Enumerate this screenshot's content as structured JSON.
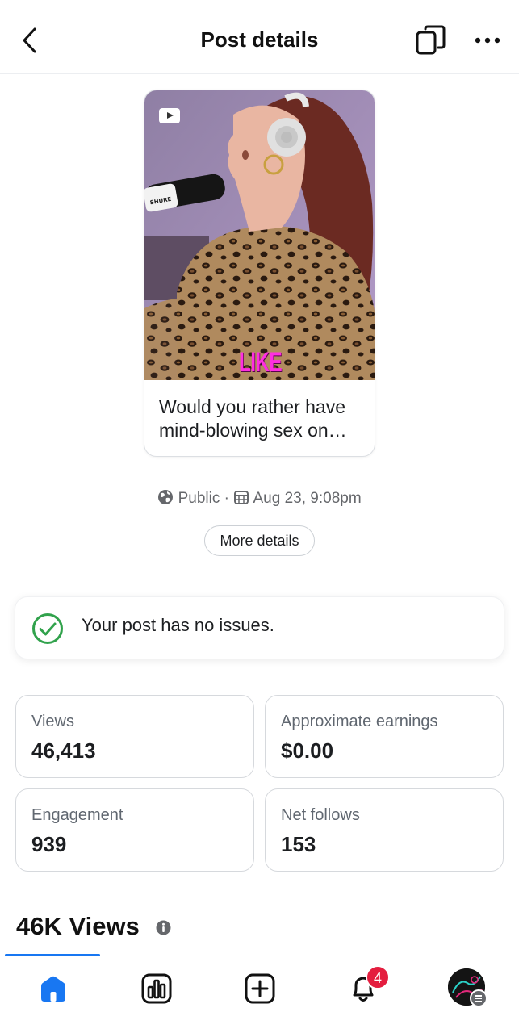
{
  "header": {
    "title": "Post details"
  },
  "post": {
    "caption_overlay": "LIKE",
    "text": "Would you rather have mind-blowing sex on…",
    "visibility": "Public",
    "separator": "·",
    "date": "Aug 23, 9:08pm",
    "more_details_label": "More details"
  },
  "status": {
    "message": "Your post has no issues.",
    "color": "#31a24c"
  },
  "stats": [
    {
      "label": "Views",
      "value": "46,413"
    },
    {
      "label": "Approximate earnings",
      "value": "$0.00"
    },
    {
      "label": "Engagement",
      "value": "939"
    },
    {
      "label": "Net follows",
      "value": "153"
    }
  ],
  "views_section": {
    "heading": "46K Views"
  },
  "bottom_nav": {
    "items": [
      "home-icon",
      "insights-icon",
      "create-icon",
      "notifications-icon",
      "profile-avatar"
    ],
    "notification_count": "4",
    "accent": "#1877f2"
  }
}
